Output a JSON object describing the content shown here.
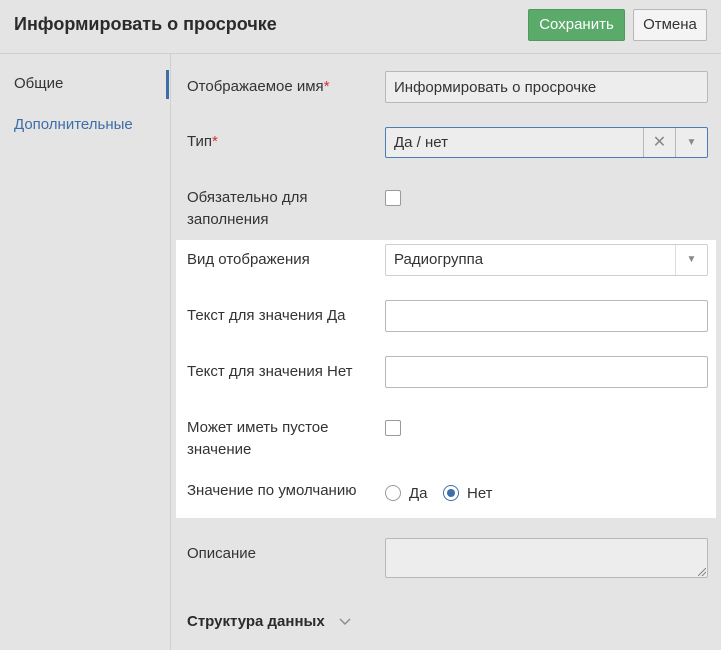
{
  "header": {
    "title": "Информировать о просрочке",
    "save_label": "Сохранить",
    "cancel_label": "Отмена",
    "save_color": "#5aaa6a"
  },
  "sidebar": {
    "items": [
      {
        "label": "Общие",
        "active": true
      },
      {
        "label": "Дополнительные",
        "active": false
      }
    ],
    "accent": "#3d6ea8"
  },
  "form": {
    "display_name": {
      "label": "Отображаемое имя",
      "required": "*",
      "value": "Информировать о просрочке"
    },
    "type": {
      "label": "Тип",
      "required": "*",
      "value": "Да / нет",
      "clear_icon": "close-icon",
      "arrow_icon": "caret-down-icon"
    },
    "mandatory": {
      "label_line1": "Обязательно для",
      "label_line2": "заполнения",
      "checked": false
    },
    "view_mode": {
      "label": "Вид отображения",
      "value": "Радиогруппа"
    },
    "yes_text": {
      "label": "Текст для значения Да",
      "value": ""
    },
    "no_text": {
      "label": "Текст для значения Нет",
      "value": ""
    },
    "can_be_empty": {
      "label_line1": "Может иметь пустое",
      "label_line2": "значение",
      "checked": false
    },
    "default_value": {
      "label": "Значение по умолчанию",
      "options": [
        {
          "label": "Да",
          "selected": false
        },
        {
          "label": "Нет",
          "selected": true
        }
      ]
    },
    "description": {
      "label": "Описание",
      "value": ""
    },
    "data_structure": {
      "label": "Структура данных",
      "expanded": false
    }
  }
}
